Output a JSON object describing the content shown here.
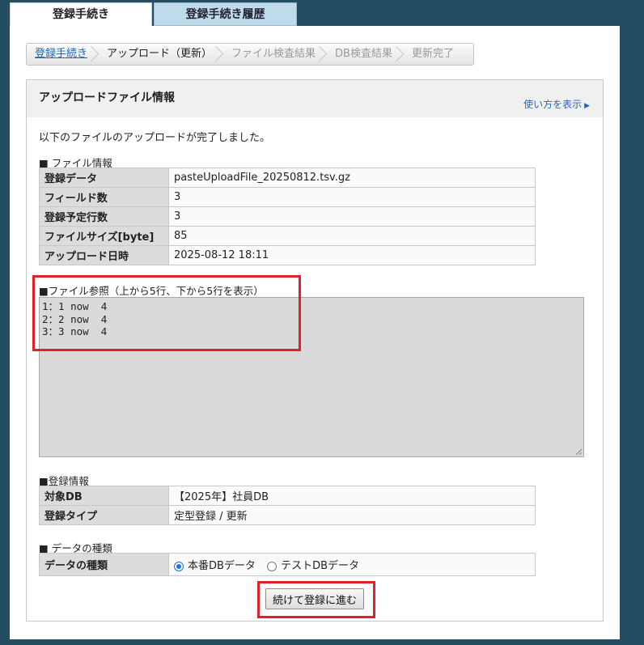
{
  "tabs": [
    {
      "label": "登録手続き",
      "active": true
    },
    {
      "label": "登録手続き履歴",
      "active": false
    }
  ],
  "breadcrumb": [
    {
      "label": "登録手続き",
      "state": "link"
    },
    {
      "label": "アップロード（更新）",
      "state": "current"
    },
    {
      "label": "ファイル検査結果",
      "state": "disabled"
    },
    {
      "label": "DB検査結果",
      "state": "disabled"
    },
    {
      "label": "更新完了",
      "state": "disabled"
    }
  ],
  "box": {
    "title": "アップロードファイル情報",
    "help_link": "使い方を表示",
    "message": "以下のファイルのアップロードが完了しました。"
  },
  "file_info": {
    "heading": "■ ファイル情報",
    "rows": [
      {
        "label": "登録データ",
        "value": "pasteUploadFile_20250812.tsv.gz"
      },
      {
        "label": "フィールド数",
        "value": "3"
      },
      {
        "label": "登録予定行数",
        "value": "3"
      },
      {
        "label": "ファイルサイズ[byte]",
        "value": "85"
      },
      {
        "label": "アップロード日時",
        "value": "2025-08-12 18:11"
      }
    ]
  },
  "file_preview": {
    "heading": "■ファイル参照（上から5行、下から5行を表示）",
    "lines": [
      "1：1 now  4",
      "2：2 now  4",
      "3：3 now  4"
    ]
  },
  "registration_info": {
    "heading": "■登録情報",
    "rows": [
      {
        "label": "対象DB",
        "value": "【2025年】社員DB"
      },
      {
        "label": "登録タイプ",
        "value": "定型登録 / 更新"
      }
    ]
  },
  "data_type": {
    "heading": "■ データの種類",
    "label": "データの種類",
    "options": [
      {
        "label": "本番DBデータ",
        "selected": true
      },
      {
        "label": "テストDBデータ",
        "selected": false
      }
    ]
  },
  "submit_label": "続けて登録に進む",
  "colors": {
    "background": "#244d62",
    "highlight": "#e0212b",
    "link": "#2a64b6"
  }
}
